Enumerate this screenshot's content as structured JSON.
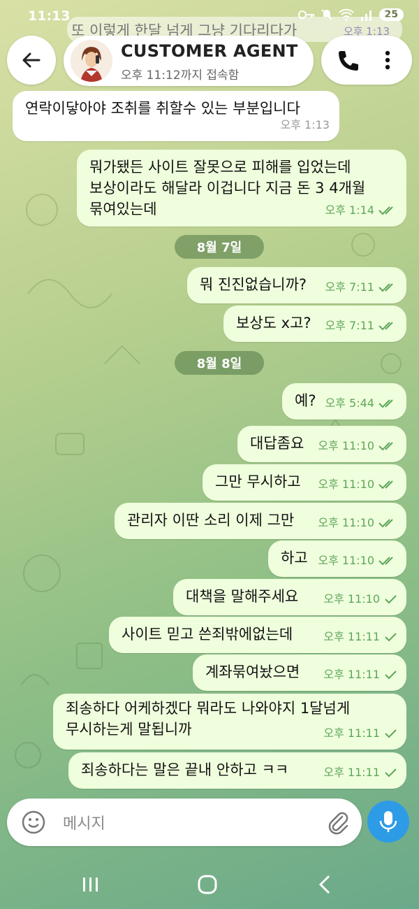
{
  "status": {
    "time": "11:13",
    "battery": "25"
  },
  "faded_message": {
    "text": "또 이렇게 한달 넘게 그냥 기다리다가",
    "time": "오후 1:13"
  },
  "header": {
    "name": "CUSTOMER AGENT",
    "last_seen": "오후 11:12까지 접속함"
  },
  "messages": [
    {
      "dir": "in",
      "text": "연락이닿아야 조취를 취할수 있는 부분입니다",
      "time": "오후 1:13"
    },
    {
      "dir": "out",
      "text": "뭐가됐든 사이트 잘못으로 피해를 입었는데\n보상이라도 해달라 이겁니다 지금 돈 3 4개월\n묶여있는데",
      "time": "오후 1:14",
      "status": "read"
    },
    {
      "dir": "out",
      "text": "뭐 진진없습니까?",
      "time": "오후 7:11",
      "status": "read"
    },
    {
      "dir": "out",
      "text": "보상도 x고?",
      "time": "오후 7:11",
      "status": "read"
    },
    {
      "dir": "out",
      "text": "예?",
      "time": "오후 5:44",
      "status": "read"
    },
    {
      "dir": "out",
      "text": "대답좀요",
      "time": "오후 11:10",
      "status": "read"
    },
    {
      "dir": "out",
      "text": "그만 무시하고",
      "time": "오후 11:10",
      "status": "read"
    },
    {
      "dir": "out",
      "text": "관리자 이딴 소리 이제 그만",
      "time": "오후 11:10",
      "status": "read"
    },
    {
      "dir": "out",
      "text": "하고",
      "time": "오후 11:10",
      "status": "read"
    },
    {
      "dir": "out",
      "text": "대책을 말해주세요",
      "time": "오후 11:10",
      "status": "sent"
    },
    {
      "dir": "out",
      "text": "사이트 믿고 쓴죄밖에없는데",
      "time": "오후 11:11",
      "status": "sent"
    },
    {
      "dir": "out",
      "text": "계좌묶여놨으면",
      "time": "오후 11:11",
      "status": "sent"
    },
    {
      "dir": "out",
      "text": "죄송하다 어케하겠다 뭐라도 나와야지 1달넘게\n무시하는게 말됩니까",
      "time": "오후 11:11",
      "status": "sent"
    },
    {
      "dir": "out",
      "text": "죄송하다는 말은 끝내 안하고 ㅋㅋ",
      "time": "오후 11:11",
      "status": "sent"
    }
  ],
  "date_chips": [
    "8월 7일",
    "8월 8일"
  ],
  "composer": {
    "placeholder": "메시지"
  },
  "colors": {
    "accent": "#2e9be6",
    "outgoing_bubble": "#efffdd",
    "check": "#5fa55a"
  }
}
